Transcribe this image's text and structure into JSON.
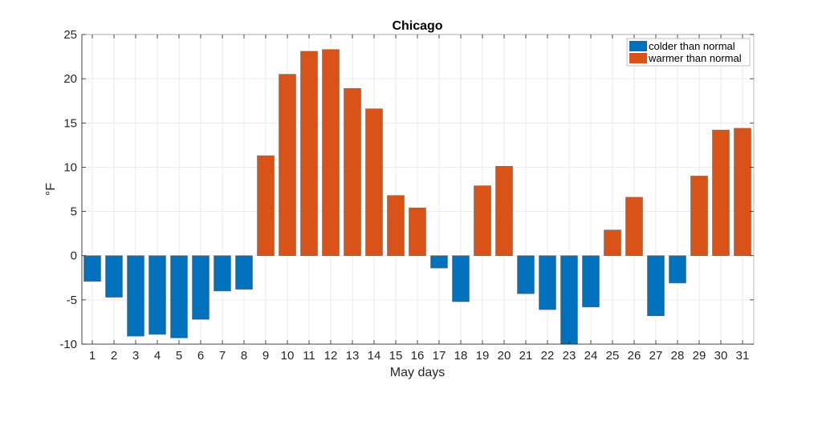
{
  "chart_data": {
    "type": "bar",
    "title": "Chicago",
    "xlabel": "May days",
    "ylabel": "°F",
    "ylim": [
      -10,
      25
    ],
    "yticks": [
      -10,
      -5,
      0,
      5,
      10,
      15,
      20,
      25
    ],
    "grid": true,
    "legend_position": "top-right",
    "categories": [
      "1",
      "2",
      "3",
      "4",
      "5",
      "6",
      "7",
      "8",
      "9",
      "10",
      "11",
      "12",
      "13",
      "14",
      "15",
      "16",
      "17",
      "18",
      "19",
      "20",
      "21",
      "22",
      "23",
      "24",
      "25",
      "26",
      "27",
      "28",
      "29",
      "30",
      "31"
    ],
    "values": [
      -2.9,
      -4.7,
      -9.1,
      -8.9,
      -9.3,
      -7.2,
      -4.0,
      -3.8,
      11.3,
      20.5,
      23.1,
      23.3,
      18.9,
      16.6,
      6.8,
      5.4,
      -1.4,
      -5.2,
      7.9,
      10.1,
      -4.3,
      -6.1,
      -10.0,
      -5.8,
      2.9,
      6.6,
      -6.8,
      -3.1,
      9.0,
      14.2,
      14.4
    ],
    "series": [
      {
        "name": "colder than normal",
        "color": "#0072BD",
        "rule": "value < 0"
      },
      {
        "name": "warmer than normal",
        "color": "#D95319",
        "rule": "value >= 0"
      }
    ]
  }
}
